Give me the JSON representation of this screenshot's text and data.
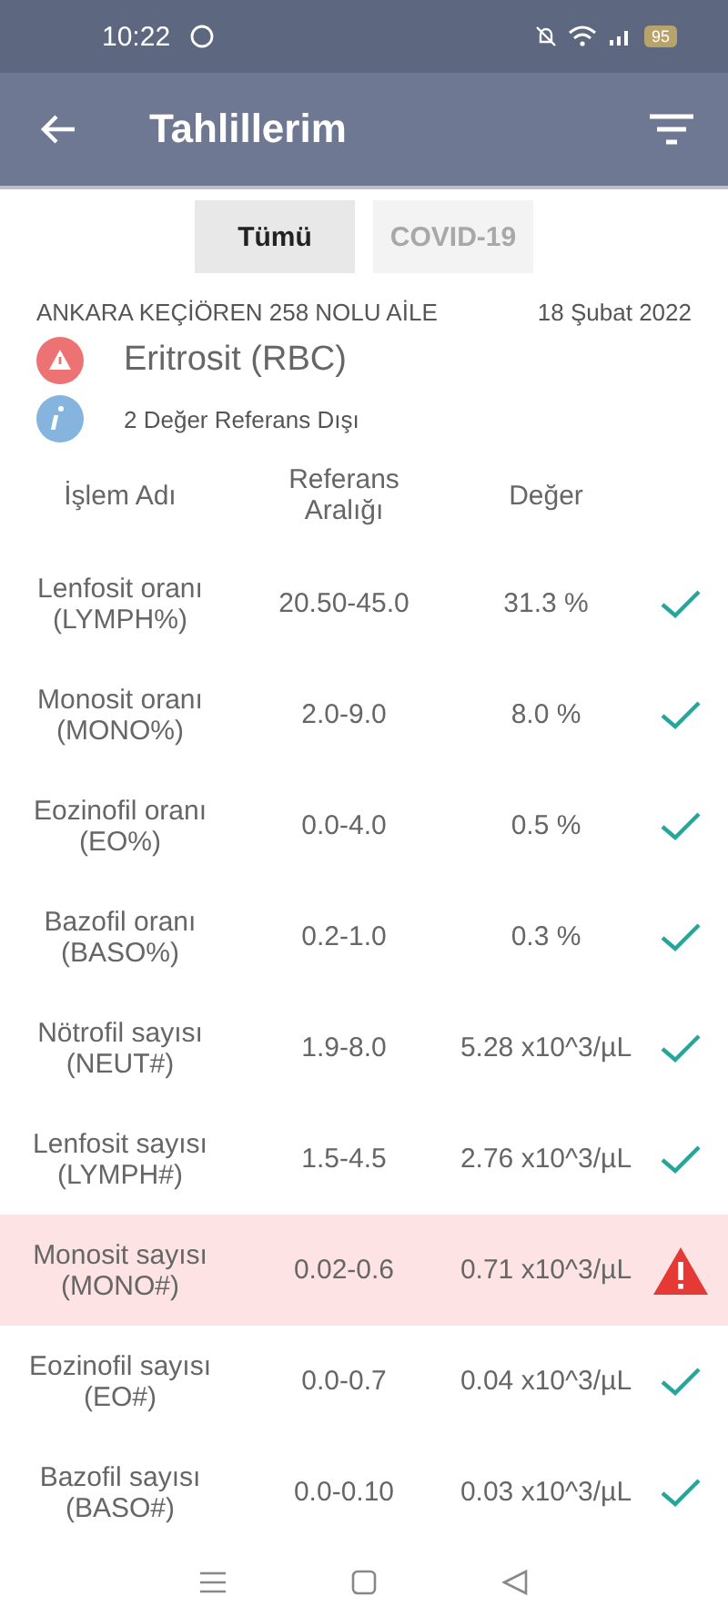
{
  "status_bar": {
    "time": "10:22",
    "battery": "95"
  },
  "app_bar": {
    "title": "Tahlillerim"
  },
  "tabs": [
    {
      "label": "Tümü",
      "selected": true
    },
    {
      "label": "COVID-19",
      "selected": false
    }
  ],
  "summary": {
    "institution": "ANKARA KEÇİÖREN 258 NOLU AİLE",
    "date": "18 Şubat 2022",
    "test_name": "Eritrosit (RBC)",
    "note": "2 Değer Referans Dışı"
  },
  "table": {
    "columns": [
      "İşlem Adı",
      "Referans Aralığı",
      "Değer"
    ],
    "rows": [
      {
        "name": "Lenfosit oranı (LYMPH%)",
        "range": "20.50-45.0",
        "value": "31.3 %",
        "flagged": false
      },
      {
        "name": "Monosit oranı (MONO%)",
        "range": "2.0-9.0",
        "value": "8.0 %",
        "flagged": false
      },
      {
        "name": "Eozinofil oranı (EO%)",
        "range": "0.0-4.0",
        "value": "0.5 %",
        "flagged": false
      },
      {
        "name": "Bazofil oranı (BASO%)",
        "range": "0.2-1.0",
        "value": "0.3 %",
        "flagged": false
      },
      {
        "name": "Nötrofil sayısı (NEUT#)",
        "range": "1.9-8.0",
        "value": "5.28 x10^3/µL",
        "flagged": false
      },
      {
        "name": "Lenfosit sayısı (LYMPH#)",
        "range": "1.5-4.5",
        "value": "2.76 x10^3/µL",
        "flagged": false
      },
      {
        "name": "Monosit sayısı (MONO#)",
        "range": "0.02-0.6",
        "value": "0.71 x10^3/µL",
        "flagged": true
      },
      {
        "name": "Eozinofil sayısı (EO#)",
        "range": "0.0-0.7",
        "value": "0.04 x10^3/µL",
        "flagged": false
      },
      {
        "name": "Bazofil sayısı (BASO#)",
        "range": "0.0-0.10",
        "value": "0.03 x10^3/µL",
        "flagged": false
      }
    ]
  }
}
